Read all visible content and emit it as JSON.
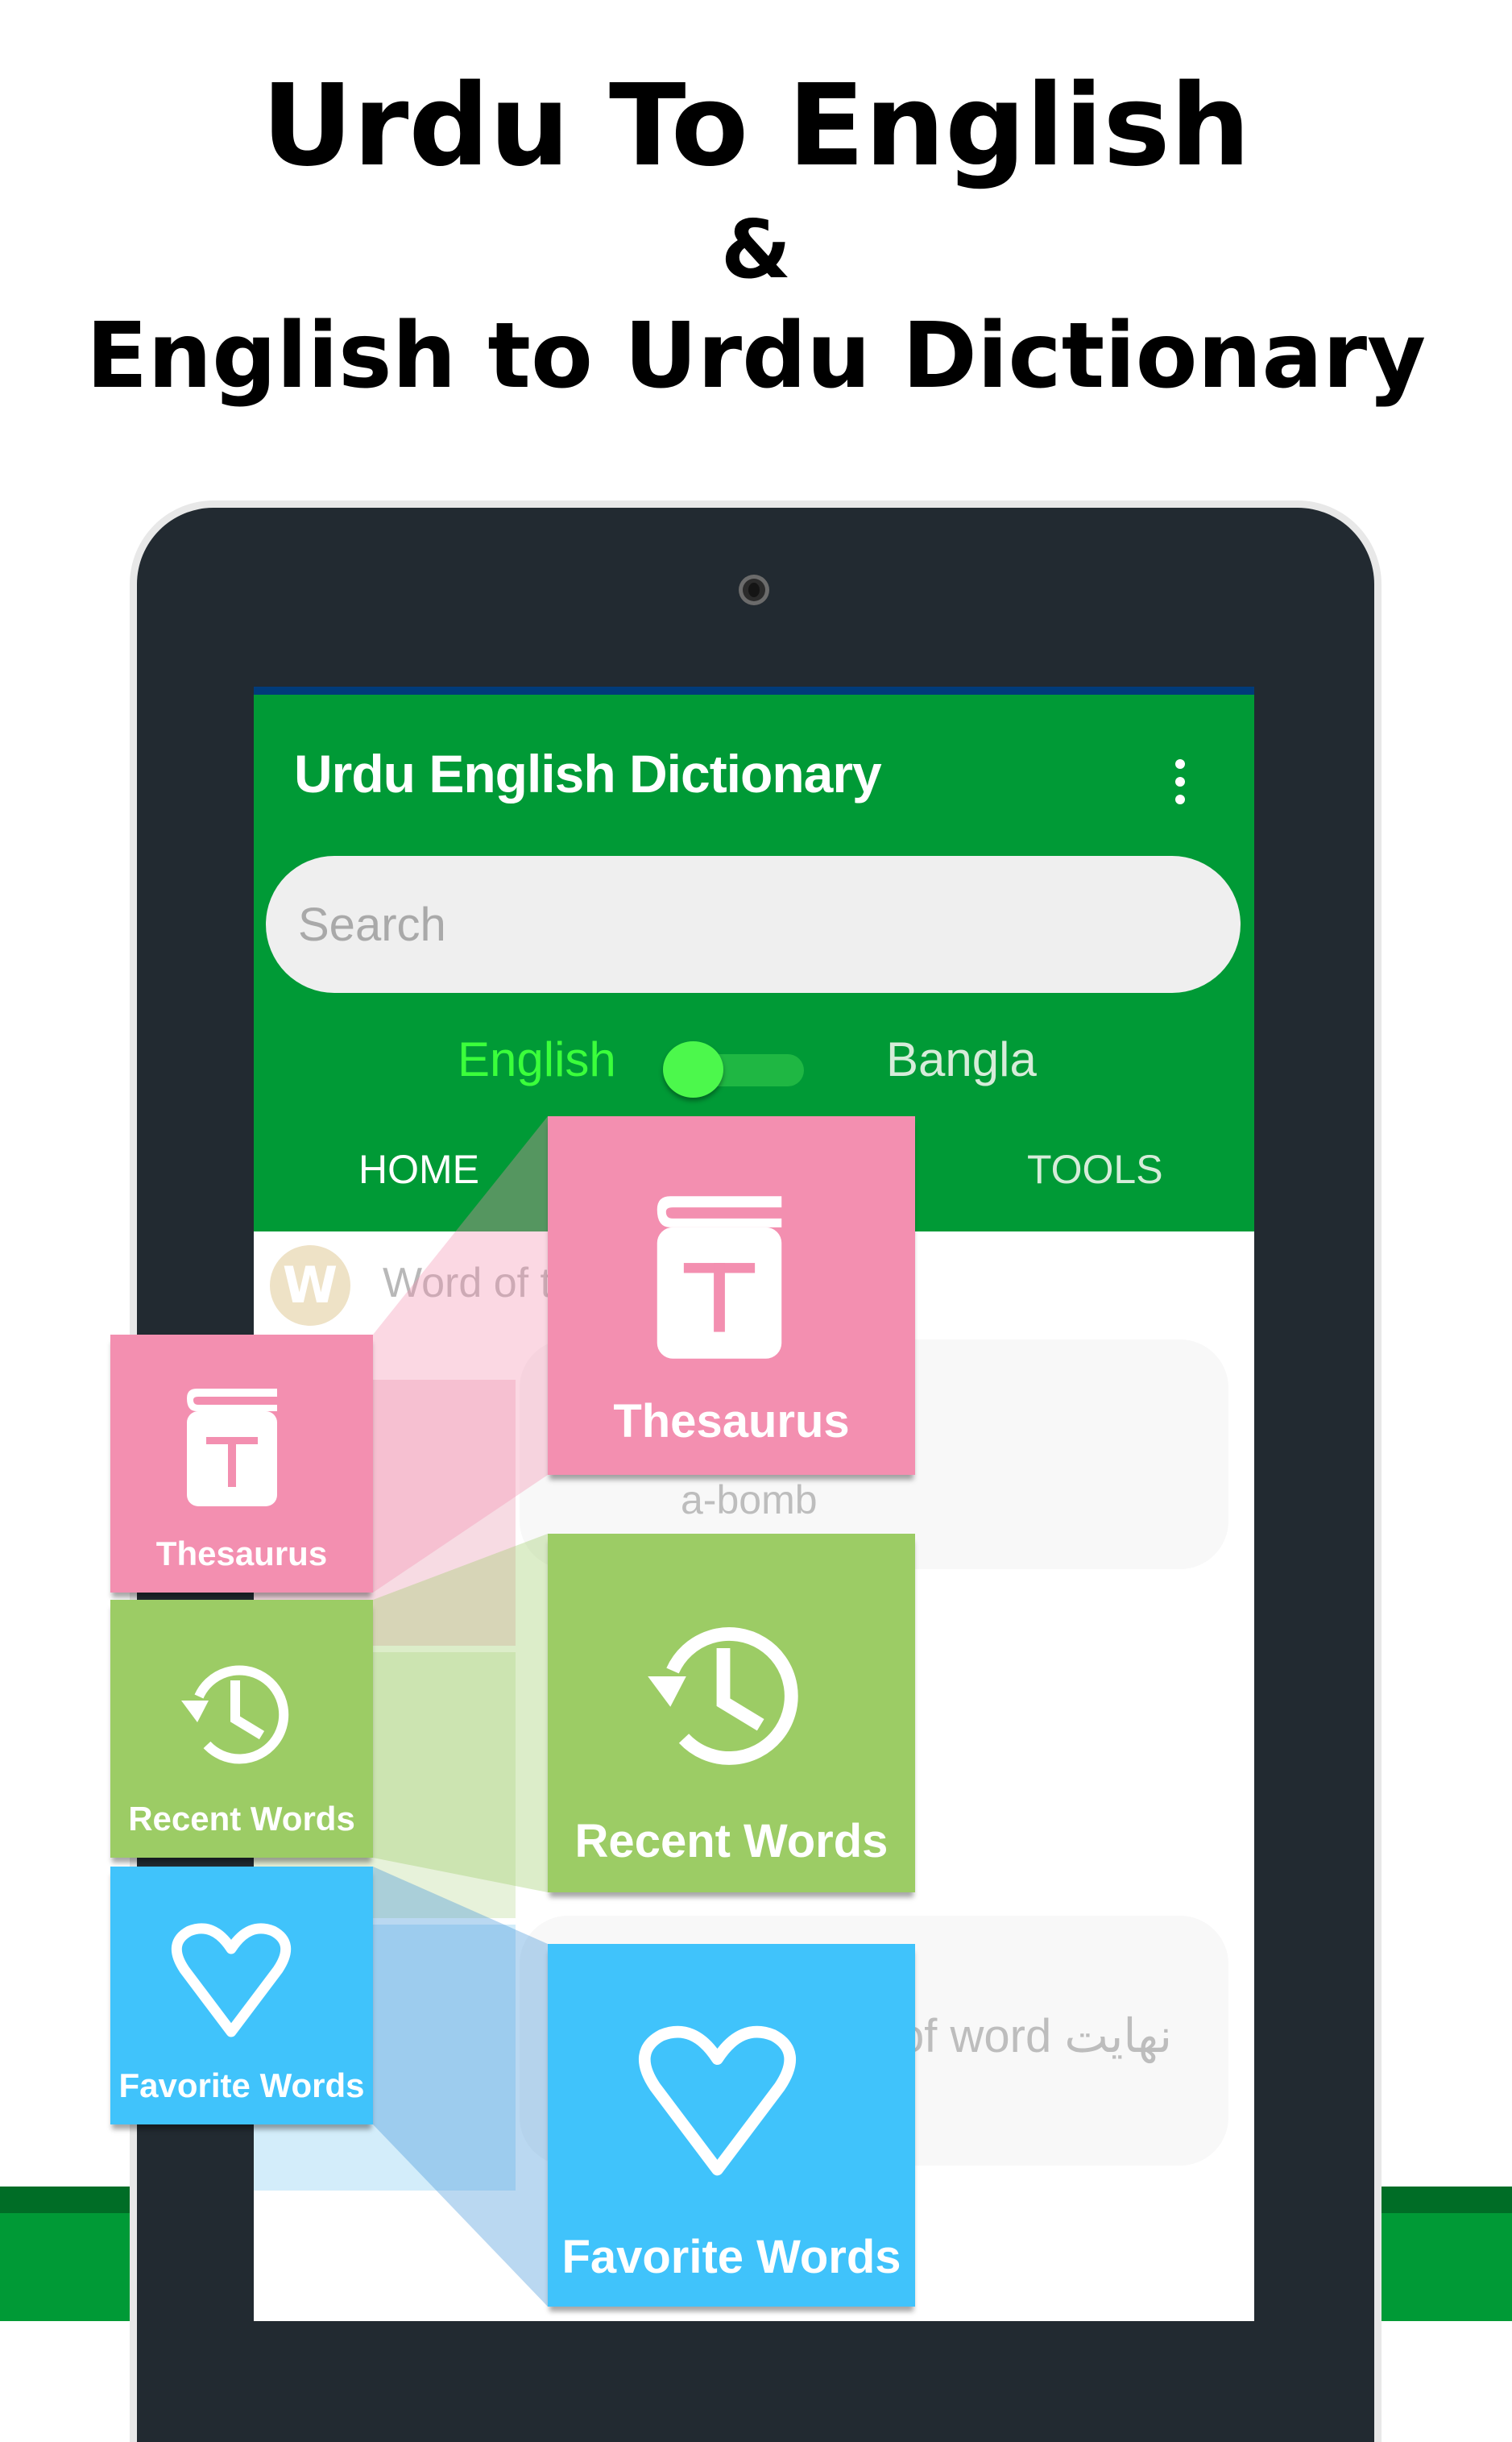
{
  "headline": {
    "line1": "Urdu To English",
    "line2": "&",
    "line3": "English to Urdu Dictionary"
  },
  "app": {
    "title": "Urdu English Dictionary",
    "menu_icon": "more-vert-icon",
    "search_placeholder": "Search",
    "search_value": "",
    "language_toggle": {
      "left_label": "English",
      "right_label": "Bangla",
      "active": "English"
    },
    "tabs": [
      {
        "label": "HOME",
        "active": true
      },
      {
        "label": "TOOLS",
        "active": false
      }
    ],
    "word_of_day": {
      "avatar_letter": "W",
      "label": "Word of t"
    },
    "cards": [
      {
        "word": "a-bomb"
      },
      {
        "text": "of word نهايت"
      }
    ]
  },
  "features": [
    {
      "label": "Thesaurus",
      "icon": "book-t-icon",
      "color": "#f38fb0"
    },
    {
      "label": "Recent Words",
      "icon": "history-clock-icon",
      "color": "#9ccc65"
    },
    {
      "label": "Favorite Words",
      "icon": "heart-outline-icon",
      "color": "#40c3fb"
    }
  ],
  "colors": {
    "app_green": "#009a36",
    "tablet_frame": "#222a31",
    "toggle_thumb": "#4cf84c",
    "english_label": "#3bff3b"
  }
}
